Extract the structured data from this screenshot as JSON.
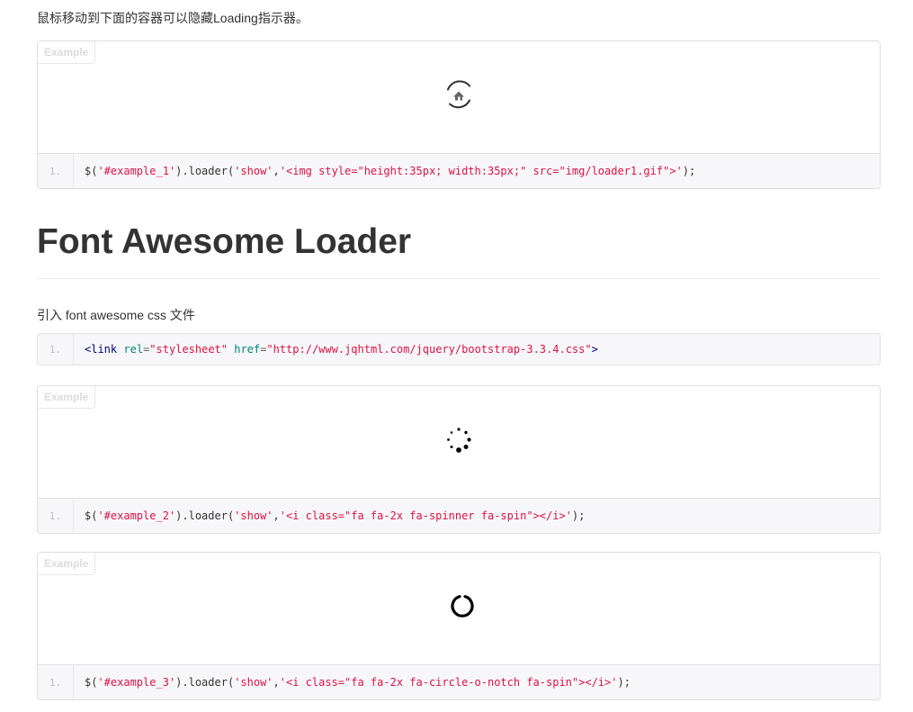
{
  "intro_text": "鼠标移动到下面的容器可以隐藏Loading指示器。",
  "example_label": "Example",
  "examples": [
    {
      "line_number": "1.",
      "code_parts": [
        "$(",
        "'#example_1'",
        ").loader(",
        "'show'",
        ",",
        "'<img style=\"height:35px; width:35px;\" src=\"img/loader1.gif\">'",
        ");"
      ],
      "loader_icon": "home-spinner-gif"
    },
    {
      "line_number": "1.",
      "code_parts": [
        "$(",
        "'#example_2'",
        ").loader(",
        "'show'",
        ",",
        "'<i class=\"fa fa-2x fa-spinner fa-spin\"></i>'",
        ");"
      ],
      "loader_icon": "dot-spinner-icon"
    },
    {
      "line_number": "1.",
      "code_parts": [
        "$(",
        "'#example_3'",
        ").loader(",
        "'show'",
        ",",
        "'<i class=\"fa fa-2x fa-circle-o-notch fa-spin\"></i>'",
        ");"
      ],
      "loader_icon": "circle-notch-icon"
    }
  ],
  "section_title": "Font Awesome Loader",
  "section_subtext": "引入 font awesome css 文件",
  "link_code": {
    "line_number": "1.",
    "open": "<",
    "tag": "link",
    "attr1_name": "rel",
    "eq1": "=",
    "attr1_value": "\"stylesheet\"",
    "attr2_name": "href",
    "eq2": "=",
    "attr2_value": "\"http://www.jqhtml.com/jquery/bootstrap-3.3.4.css\"",
    "close": ">"
  },
  "colors": {
    "string": "#dd1144",
    "tag": "#000080",
    "attribute_name": "#008080",
    "line_number": "#bebec5",
    "code_background": "#f7f7f9"
  }
}
